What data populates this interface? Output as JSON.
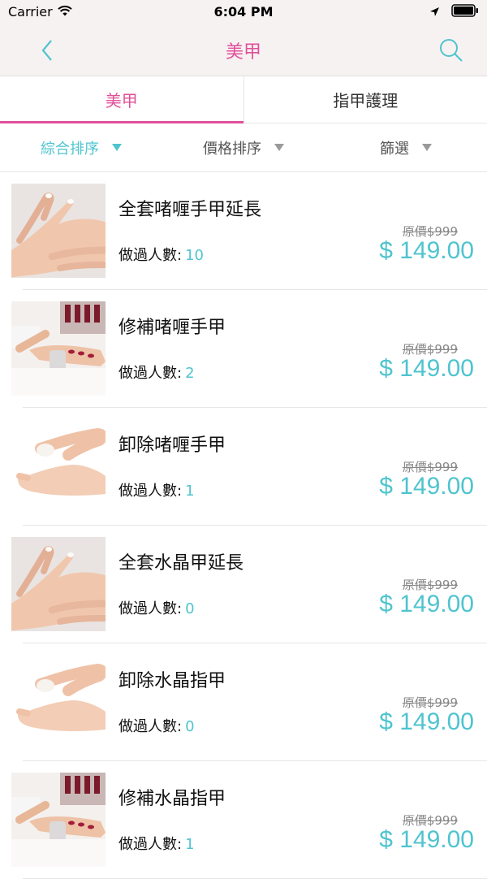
{
  "status": {
    "carrier": "Carrier",
    "time": "6:04 PM"
  },
  "nav": {
    "title": "美甲",
    "back_icon": "chevron-left-icon",
    "search_icon": "search-icon"
  },
  "tabs": [
    {
      "label": "美甲",
      "active": true
    },
    {
      "label": "指甲護理",
      "active": false
    }
  ],
  "sort": [
    {
      "label": "綜合排序",
      "active": true
    },
    {
      "label": "價格排序",
      "active": false
    },
    {
      "label": "篩選",
      "active": false
    }
  ],
  "count_label": "做過人數:",
  "items": [
    {
      "name": "全套啫喱手甲延長",
      "count": "10",
      "original": "原價$999",
      "price": "$ 149.00",
      "image": "hands-manicure"
    },
    {
      "name": "修補啫喱手甲",
      "count": "2",
      "original": "原價$999",
      "price": "$ 149.00",
      "image": "nail-painting"
    },
    {
      "name": "卸除啫喱手甲",
      "count": "1",
      "original": "原價$999",
      "price": "$ 149.00",
      "image": "nail-removal"
    },
    {
      "name": "全套水晶甲延長",
      "count": "0",
      "original": "原價$999",
      "price": "$ 149.00",
      "image": "hands-manicure"
    },
    {
      "name": "卸除水晶指甲",
      "count": "0",
      "original": "原價$999",
      "price": "$ 149.00",
      "image": "nail-removal"
    },
    {
      "name": "修補水晶指甲",
      "count": "1",
      "original": "原價$999",
      "price": "$ 149.00",
      "image": "nail-painting"
    }
  ],
  "colors": {
    "accent_pink": "#e0509a",
    "accent_teal": "#4fc4cf"
  }
}
